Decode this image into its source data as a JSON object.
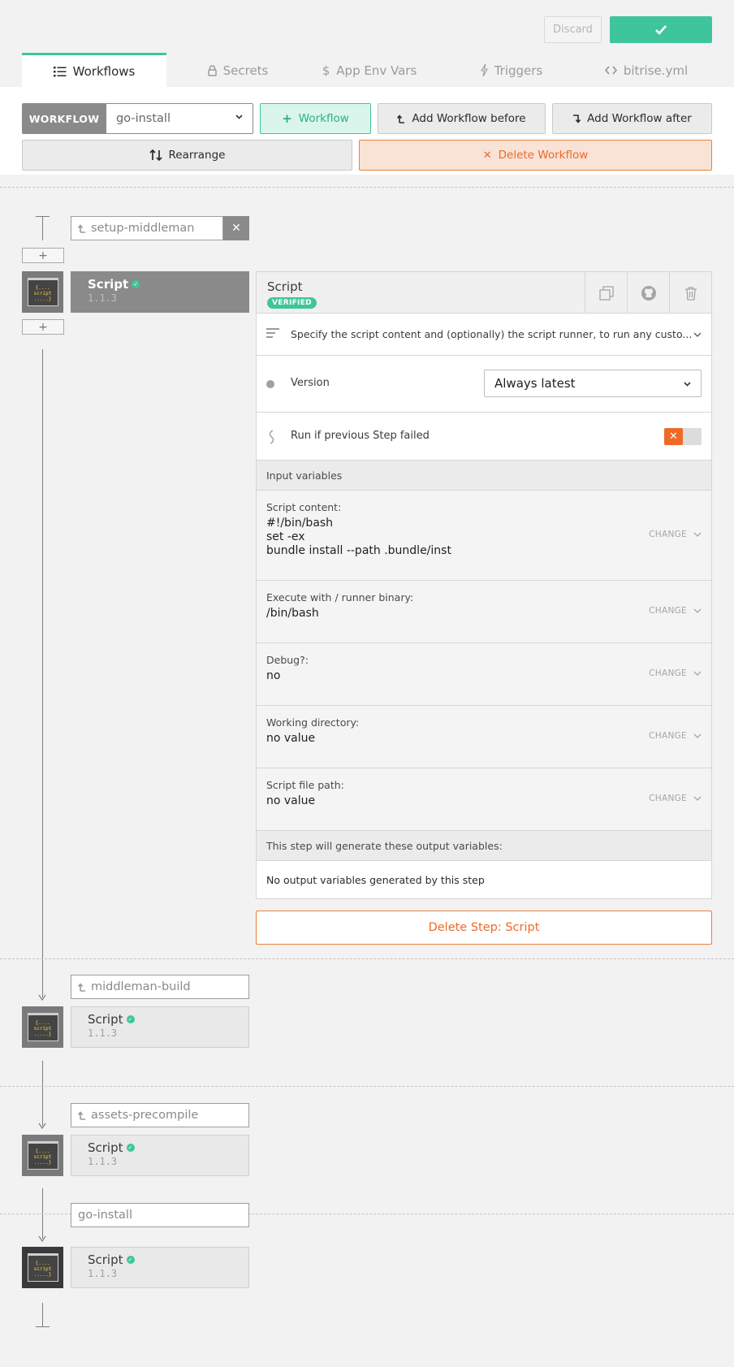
{
  "header": {
    "discard_label": "Discard",
    "save_icon": "checkmark-icon"
  },
  "tabs": [
    {
      "label": "Workflows",
      "icon": "list-icon",
      "active": true
    },
    {
      "label": "Secrets",
      "icon": "lock-icon"
    },
    {
      "label": "App Env Vars",
      "icon": "dollar-icon"
    },
    {
      "label": "Triggers",
      "icon": "bolt-icon"
    },
    {
      "label": "bitrise.yml",
      "icon": "code-icon"
    }
  ],
  "toolbar": {
    "workflow_label": "WORKFLOW",
    "workflow_selected": "go-install",
    "add_workflow": "Workflow",
    "add_before": "Add Workflow before",
    "add_after": "Add Workflow after",
    "rearrange": "Rearrange",
    "delete_workflow": "Delete Workflow"
  },
  "timeline": {
    "plus_label": "+",
    "groups": [
      {
        "workflow": "setup-middleman",
        "step_name": "Script",
        "step_version": "1.1.3"
      },
      {
        "workflow": "middleman-build",
        "step_name": "Script",
        "step_version": "1.1.3"
      },
      {
        "workflow": "assets-precompile",
        "step_name": "Script",
        "step_version": "1.1.3"
      },
      {
        "workflow": "go-install",
        "step_name": "Script",
        "step_version": "1.1.3"
      }
    ]
  },
  "step_icon_text": [
    "{....",
    "script",
    ".....}"
  ],
  "detail": {
    "title": "Script",
    "verified": "VERIFIED",
    "description": "Specify the script content and (optionally) the script runner, to run any custo...",
    "version_label": "Version",
    "version_value": "Always latest",
    "run_if_failed_label": "Run if previous Step failed",
    "run_if_failed_enabled": false,
    "input_header": "Input variables",
    "change_label": "CHANGE",
    "inputs": [
      {
        "label": "Script content:",
        "value": [
          "#!/bin/bash",
          "set -ex",
          "bundle install --path .bundle/inst"
        ]
      },
      {
        "label": "Execute with / runner binary:",
        "value": [
          "/bin/bash"
        ]
      },
      {
        "label": "Debug?:",
        "value": [
          "no"
        ]
      },
      {
        "label": "Working directory:",
        "value": [
          "no value"
        ]
      },
      {
        "label": "Script file path:",
        "value": [
          "no value"
        ]
      }
    ],
    "output_header": "This step will generate these output variables:",
    "output_text": "No output variables generated by this step",
    "delete_step": "Delete Step: Script"
  },
  "colors": {
    "accent": "#3fc59c",
    "danger": "#ee6a26",
    "muted": "#8a8a8a"
  }
}
